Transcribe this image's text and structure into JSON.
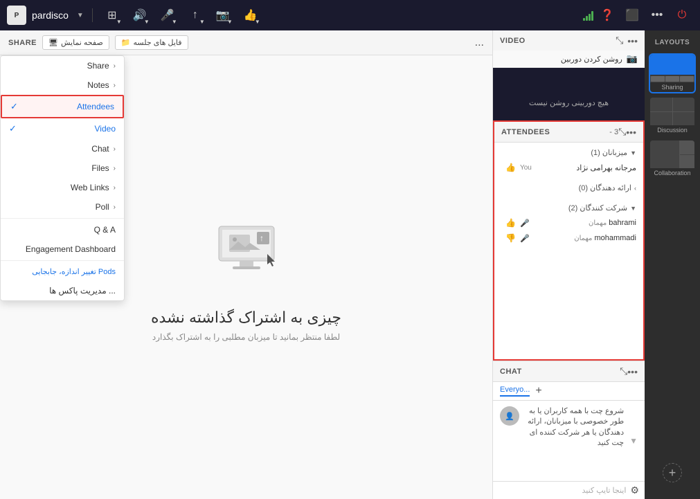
{
  "app": {
    "name": "pardisco",
    "logo": "P"
  },
  "topbar": {
    "icons": [
      "grid",
      "mic",
      "video",
      "raise-hand",
      "more"
    ],
    "right_icons": [
      "settings",
      "help",
      "record",
      "more",
      "power"
    ]
  },
  "share_bar": {
    "label": "SHARE",
    "file_btn": "فایل های جلسه",
    "display_btn": "صفحه نمایش",
    "more": "..."
  },
  "dropdown": {
    "items": [
      {
        "icon": "›",
        "label": "Share",
        "check": "",
        "hasArrow": true
      },
      {
        "icon": "›",
        "label": "Notes",
        "check": "",
        "hasArrow": true
      },
      {
        "icon": "✓",
        "label": "Attendees",
        "check": "✓",
        "highlighted": true,
        "hasArrow": false
      },
      {
        "icon": "✓",
        "label": "Video",
        "check": "✓",
        "blue": true,
        "hasArrow": false
      },
      {
        "icon": "›",
        "label": "Chat",
        "check": "",
        "hasArrow": true
      },
      {
        "icon": "›",
        "label": "Files",
        "check": "",
        "hasArrow": true
      },
      {
        "icon": "›",
        "label": "Web Links",
        "check": "",
        "hasArrow": true
      },
      {
        "icon": "›",
        "label": "Poll",
        "check": "",
        "hasArrow": true
      },
      {
        "label": "Q & A",
        "check": "",
        "hasArrow": false
      },
      {
        "label": "Engagement Dashboard",
        "check": "",
        "hasArrow": false
      },
      {
        "label": "تغییر اندازه، جابجایی Pods",
        "check": "",
        "blue": true,
        "hasArrow": false
      },
      {
        "label": "مدیریت پاکس ها ...",
        "check": "",
        "hasArrow": false
      }
    ]
  },
  "sharing": {
    "title": "چیزی به اشتراک گذاشته نشده",
    "subtitle": "لطفا منتظر بمانید تا میزبان مطلبی را به اشتراک بگذارد"
  },
  "video_panel": {
    "title": "VIDEO",
    "camera_label": "روشن کردن دوربین",
    "no_camera_text": "هیچ دوربینی روشن نیست"
  },
  "attendees_panel": {
    "title": "ATTENDEES",
    "count": "3",
    "groups": [
      {
        "name": "میزبانان (1)",
        "members": [
          {
            "name": "مرجانه بهرامی نژاد",
            "you": "You",
            "icon": "👍",
            "iconType": "thumb-up"
          }
        ]
      },
      {
        "name": "ارائه دهندگان (0)",
        "members": []
      },
      {
        "name": "شرکت کنندگان (2)",
        "members": [
          {
            "name": "bahrami",
            "label": "مهمان",
            "icon": "👍",
            "iconType": "thumb-up",
            "mic": "🎤"
          },
          {
            "name": "mohammadi",
            "label": "مهمان",
            "icon": "👎",
            "iconType": "thumb-down",
            "mic": "🎤"
          }
        ]
      }
    ]
  },
  "chat_panel": {
    "title": "CHAT",
    "tab_everyone": "Everyo...",
    "tab_plus": "+",
    "message": "شروع چت با همه کاربران یا به طور خصوصی با میزبانان، ارائه دهندگان یا هر شرکت کننده ای چت کنید",
    "input_placeholder": "اینجا تایپ کنید"
  },
  "layouts": {
    "title": "LAYOUTS",
    "items": [
      {
        "label": "Sharing",
        "active": true
      },
      {
        "label": "Discussion",
        "active": false
      },
      {
        "label": "Collaboration",
        "active": false
      }
    ]
  }
}
